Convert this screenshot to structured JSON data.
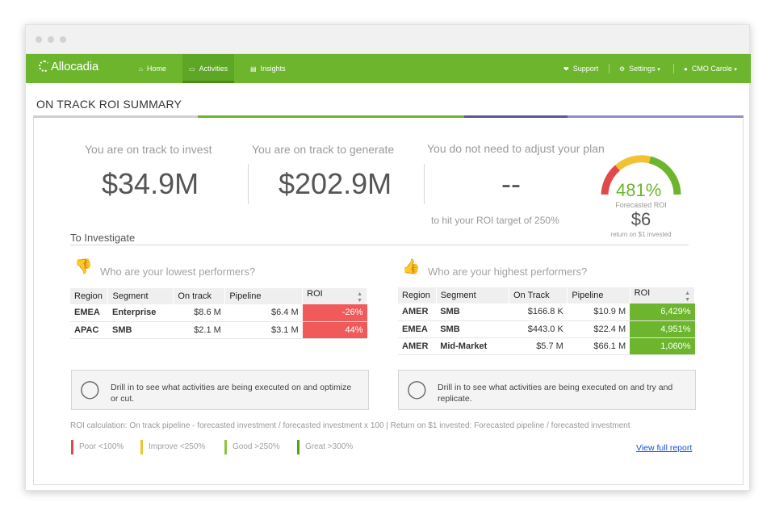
{
  "app": {
    "logo": "Allocadia"
  },
  "nav": {
    "items": [
      {
        "label": "Home",
        "icon": "home-icon"
      },
      {
        "label": "Activities",
        "icon": "monitor-icon"
      },
      {
        "label": "Insights",
        "icon": "bar-chart-icon"
      }
    ],
    "right": [
      {
        "label": "Support",
        "icon": "heart-icon"
      },
      {
        "label": "Settings",
        "icon": "gear-icon"
      },
      {
        "label": "CMO Carole",
        "icon": "user-icon"
      }
    ]
  },
  "page": {
    "title": "ON TRACK ROI SUMMARY"
  },
  "kpis": {
    "invest_label": "You are on track to invest",
    "invest_value": "$34.9M",
    "generate_label": "You are on track to generate",
    "generate_value": "$202.9M",
    "adjust_label": "You do not need to adjust your plan",
    "adjust_value": "--",
    "target_text": "to hit your ROI target of 250%"
  },
  "gauge": {
    "percent": "481%",
    "label": "Forecasted ROI",
    "return_value": "$6",
    "return_label": "return on $1 invested",
    "colors": [
      "#e24a4a",
      "#f1c232",
      "#6cb52d"
    ]
  },
  "investigate": {
    "heading": "To Investigate"
  },
  "lowest": {
    "heading": "Who are your lowest performers?",
    "columns": [
      "Region",
      "Segment",
      "On track",
      "Pipeline",
      "ROI"
    ],
    "rows": [
      {
        "region": "EMEA",
        "segment": "Enterprise",
        "on_track": "$8.6 M",
        "pipeline": "$6.4 M",
        "roi": "-26%",
        "color": "#f05a5a"
      },
      {
        "region": "APAC",
        "segment": "SMB",
        "on_track": "$2.1 M",
        "pipeline": "$3.1 M",
        "roi": "44%",
        "color": "#f05a5a"
      }
    ],
    "info": "Drill in to see what activities are being executed on and optimize or cut."
  },
  "highest": {
    "heading": "Who are your highest performers?",
    "columns": [
      "Region",
      "Segment",
      "On Track",
      "Pipeline",
      "ROI"
    ],
    "rows": [
      {
        "region": "AMER",
        "segment": "SMB",
        "on_track": "$166.8 K",
        "pipeline": "$10.9 M",
        "roi": "6,429%",
        "color": "#6cb52d"
      },
      {
        "region": "EMEA",
        "segment": "SMB",
        "on_track": "$443.0 K",
        "pipeline": "$22.4 M",
        "roi": "4,951%",
        "color": "#6cb52d"
      },
      {
        "region": "AMER",
        "segment": "Mid-Market",
        "on_track": "$5.7 M",
        "pipeline": "$66.1 M",
        "roi": "1,060%",
        "color": "#6cb52d"
      }
    ],
    "info": "Drill in to see what activities are being executed on and try and replicate."
  },
  "footer": {
    "calc": "ROI calculation: On track pipeline - forecasted investment / forecasted investment x 100 | Return on $1 invested: Forecasted pipeline / forecasted investment",
    "legend": [
      {
        "label": "Poor <100%",
        "color": "#e24a4a"
      },
      {
        "label": "Improve <250%",
        "color": "#f1c232"
      },
      {
        "label": "Good >250%",
        "color": "#8cc63f"
      },
      {
        "label": "Great >300%",
        "color": "#5a9e1f"
      }
    ],
    "link": "View full report"
  }
}
